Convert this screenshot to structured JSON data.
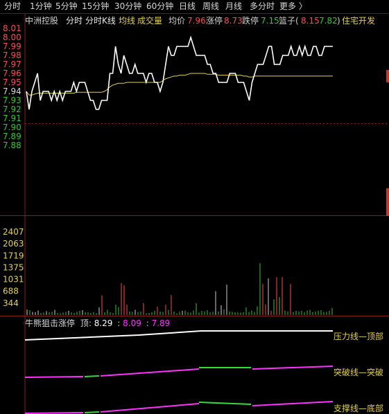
{
  "tabs": [
    "分时",
    "1分钟",
    "5分钟",
    "15分钟",
    "30分钟",
    "60分钟",
    "日线",
    "周线",
    "月线",
    "多分时",
    "更多 〉"
  ],
  "active_tab": 0,
  "info": {
    "stock_name": "中洲控股",
    "mode1": "分时",
    "mode2": "分时K线",
    "avg_line_label": "均线",
    "volume_label": "成交量",
    "avg_price_label": "均价",
    "avg_price": "7.96",
    "limit_up_label": "涨停",
    "limit_up": "8.73",
    "limit_down_label": "跌停",
    "limit_down": "7.15",
    "basket_label": "篮子(",
    "basket_v1": "8.15",
    "basket_v2": "7.82",
    "basket_end": ")",
    "sector": "住宅开发"
  },
  "indicator": {
    "name": "牛熊狙击涨停",
    "top_label": "顶:",
    "top_value": "8.29",
    "colon1": ":",
    "v2": "8.09",
    "colon2": ":",
    "v3": "7.89",
    "line1_label": "压力线—顶部",
    "line2_label": "突破线—突破",
    "line3_label": "支撑线—底部"
  },
  "colors": {
    "price_line": "#ffffff",
    "avg_line": "#e6d24a",
    "up": "#ff4d4d",
    "down": "#34c934",
    "flat": "#d0d0d0",
    "label_yellow": "#e6d24a",
    "magenta": "#ff33ff",
    "green": "#33dd33",
    "grid": "#8b1a1a"
  },
  "chart_data": [
    {
      "type": "line",
      "title": "",
      "ylim": [
        7.87,
        8.01
      ],
      "y_ticks": [
        "8.01",
        "8.00",
        "7.99",
        "7.98",
        "7.97",
        "7.96",
        "7.95",
        "7.94",
        "7.93",
        "7.92",
        "7.91",
        "7.90",
        "7.89",
        "7.88"
      ],
      "series": [
        {
          "values": [
            7.94,
            7.92,
            7.94,
            7.95,
            7.96,
            7.93,
            7.94,
            7.94,
            7.94,
            7.93,
            7.94,
            7.93,
            7.94,
            7.93,
            7.94,
            7.94,
            7.94,
            7.95,
            7.94,
            7.95,
            7.95,
            7.95,
            7.94,
            7.93,
            7.93,
            7.92,
            7.92,
            7.93,
            7.93,
            7.93,
            7.96,
            7.96,
            7.99,
            7.97,
            7.96,
            7.98,
            7.97,
            7.96,
            7.96,
            7.97,
            7.96,
            7.96,
            7.96,
            7.95,
            7.96,
            7.96,
            7.95,
            7.95,
            7.94,
            7.95,
            7.97,
            7.99,
            7.98,
            7.98,
            7.99,
            7.99,
            7.99,
            7.99,
            7.99,
            8.0,
            7.99,
            7.98,
            7.98,
            7.98,
            7.98,
            7.97,
            7.97,
            7.96,
            7.96,
            7.95,
            7.95,
            7.95,
            7.95,
            7.96,
            7.96,
            7.96,
            7.95,
            7.95,
            7.95,
            7.94,
            7.93,
            7.95,
            7.96,
            7.97,
            7.97,
            7.97,
            7.98,
            7.99,
            7.99,
            7.97,
            7.97,
            7.97,
            7.98,
            7.98,
            7.98,
            7.99,
            7.98,
            7.98,
            7.99,
            7.98,
            7.99,
            7.98,
            7.98,
            7.99,
            7.99,
            7.98,
            7.98,
            7.99,
            7.99,
            7.99,
            7.99
          ]
        },
        {
          "values": [
            7.94,
            7.936,
            7.936,
            7.937,
            7.938,
            7.938,
            7.938,
            7.938,
            7.938,
            7.938,
            7.938,
            7.938,
            7.938,
            7.938,
            7.938,
            7.938,
            7.938,
            7.938,
            7.939,
            7.939,
            7.939,
            7.939,
            7.939,
            7.939,
            7.939,
            7.939,
            7.939,
            7.939,
            7.94,
            7.942,
            7.945,
            7.947,
            7.948,
            7.949,
            7.949,
            7.949,
            7.95,
            7.95,
            7.95,
            7.95,
            7.95,
            7.95,
            7.95,
            7.95,
            7.95,
            7.95,
            7.95,
            7.95,
            7.95,
            7.952,
            7.954,
            7.955,
            7.956,
            7.957,
            7.957,
            7.958,
            7.958,
            7.958,
            7.959,
            7.96,
            7.96,
            7.96,
            7.96,
            7.96,
            7.96,
            7.959,
            7.959,
            7.959,
            7.959,
            7.958,
            7.958,
            7.958,
            7.958,
            7.958,
            7.958,
            7.958,
            7.958,
            7.958,
            7.957,
            7.957,
            7.956,
            7.956,
            7.957,
            7.957,
            7.957,
            7.957,
            7.957,
            7.957,
            7.957,
            7.957,
            7.957,
            7.957,
            7.957,
            7.957,
            7.957,
            7.957,
            7.957,
            7.957,
            7.957,
            7.957,
            7.957,
            7.957,
            7.957,
            7.957,
            7.957,
            7.957,
            7.957,
            7.957,
            7.957,
            7.957,
            7.957
          ]
        }
      ]
    },
    {
      "type": "bar",
      "title": "",
      "ylim": [
        0,
        2407
      ],
      "y_ticks": [
        "2407",
        "2063",
        "1719",
        "1375",
        "1031",
        "688",
        "344"
      ],
      "series": [
        {
          "values": [
            160,
            140,
            90,
            80,
            130,
            60,
            70,
            110,
            80,
            90,
            150,
            60,
            50,
            70,
            90,
            120,
            80,
            60,
            95,
            120,
            140,
            85,
            80,
            60,
            80,
            55,
            220,
            570,
            80,
            150,
            80,
            60,
            300,
            230,
            920,
            860,
            300,
            100,
            90,
            150,
            80,
            100,
            340,
            50,
            60,
            80,
            120,
            240,
            100,
            90,
            300,
            150,
            580,
            100,
            50,
            90,
            120,
            130,
            80,
            70,
            130,
            340,
            70,
            120,
            100,
            140,
            80,
            90,
            690,
            100,
            280,
            160,
            880,
            100,
            90,
            80,
            75,
            70,
            80,
            220,
            90,
            130,
            90,
            250,
            1500,
            900,
            310,
            1060,
            120,
            450,
            1100,
            520,
            1100,
            130,
            100,
            900,
            90,
            120,
            100,
            120,
            80,
            130,
            150,
            80,
            100,
            120,
            140,
            90,
            90,
            120,
            200
          ],
          "colors": [
            "f",
            "d",
            "f",
            "f",
            "f",
            "d",
            "d",
            "f",
            "d",
            "d",
            "f",
            "d",
            "d",
            "d",
            "d",
            "f",
            "d",
            "d",
            "d",
            "d",
            "f",
            "d",
            "d",
            "d",
            "d",
            "d",
            "f",
            "u",
            "d",
            "d",
            "d",
            "d",
            "d",
            "d",
            "u",
            "u",
            "u",
            "d",
            "d",
            "f",
            "d",
            "d",
            "u",
            "d",
            "d",
            "d",
            "d",
            "u",
            "d",
            "d",
            "u",
            "d",
            "u",
            "d",
            "d",
            "d",
            "f",
            "d",
            "d",
            "d",
            "d",
            "d",
            "d",
            "d",
            "d",
            "d",
            "d",
            "d",
            "f",
            "d",
            "f",
            "d",
            "f",
            "d",
            "d",
            "d",
            "d",
            "d",
            "d",
            "d",
            "d",
            "d",
            "d",
            "d",
            "d",
            "u",
            "u",
            "f",
            "u",
            "d",
            "u",
            "d",
            "u",
            "d",
            "d",
            "u",
            "d",
            "d",
            "d",
            "d",
            "d",
            "d",
            "d",
            "d",
            "d",
            "d",
            "d",
            "d",
            "d",
            "d",
            "d"
          ]
        }
      ]
    }
  ]
}
